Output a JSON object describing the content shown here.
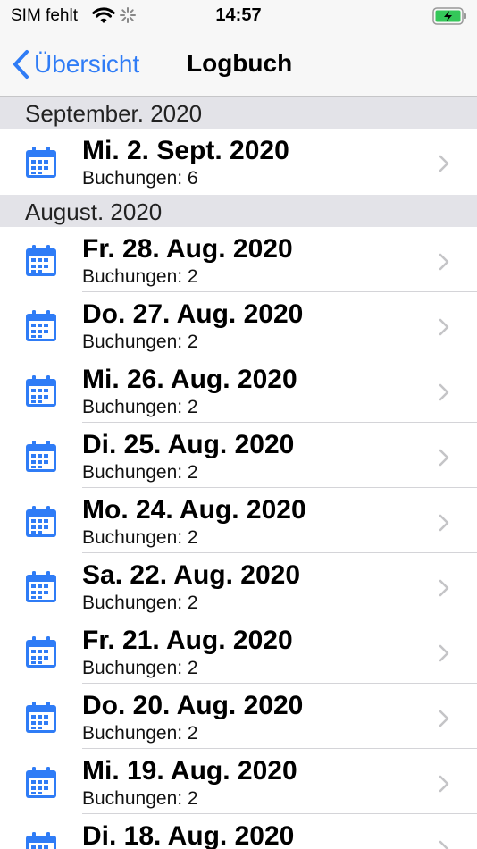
{
  "status_bar": {
    "carrier": "SIM fehlt",
    "time": "14:57",
    "icons": [
      "wifi-icon",
      "activity-spinner-icon",
      "battery-charging-icon"
    ]
  },
  "nav": {
    "back_label": "Übersicht",
    "title": "Logbuch"
  },
  "colors": {
    "accent": "#2f7cf6",
    "section_bg": "#e3e3e8",
    "battery_green": "#34c759"
  },
  "sections": [
    {
      "header": "September. 2020",
      "rows": [
        {
          "title": "Mi. 2. Sept. 2020",
          "subtitle": "Buchungen: 6"
        }
      ]
    },
    {
      "header": "August. 2020",
      "rows": [
        {
          "title": "Fr. 28. Aug. 2020",
          "subtitle": "Buchungen: 2"
        },
        {
          "title": "Do. 27. Aug. 2020",
          "subtitle": "Buchungen: 2"
        },
        {
          "title": "Mi. 26. Aug. 2020",
          "subtitle": "Buchungen: 2"
        },
        {
          "title": "Di. 25. Aug. 2020",
          "subtitle": "Buchungen: 2"
        },
        {
          "title": "Mo. 24. Aug. 2020",
          "subtitle": "Buchungen: 2"
        },
        {
          "title": "Sa. 22. Aug. 2020",
          "subtitle": "Buchungen: 2"
        },
        {
          "title": "Fr. 21. Aug. 2020",
          "subtitle": "Buchungen: 2"
        },
        {
          "title": "Do. 20. Aug. 2020",
          "subtitle": "Buchungen: 2"
        },
        {
          "title": "Mi. 19. Aug. 2020",
          "subtitle": "Buchungen: 2"
        },
        {
          "title": "Di. 18. Aug. 2020",
          "subtitle": ""
        }
      ]
    }
  ]
}
